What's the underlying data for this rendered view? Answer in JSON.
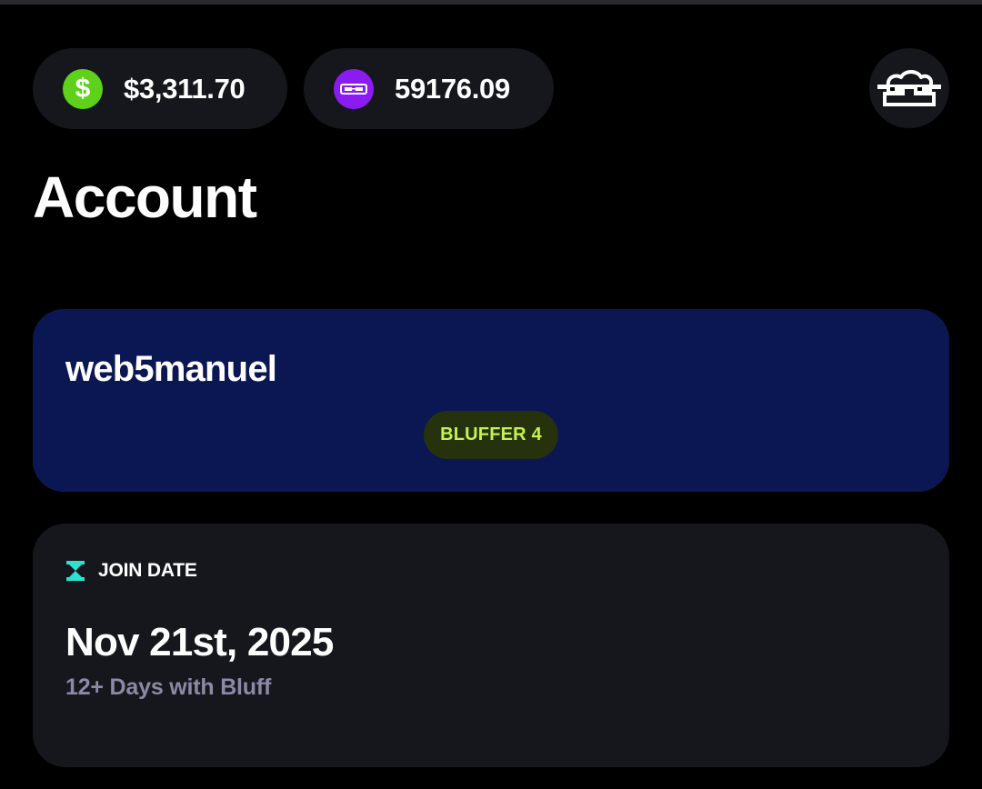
{
  "balances": {
    "cash": {
      "icon": "dollar-coin-icon",
      "symbol": "$",
      "amount": "$3,311.70"
    },
    "chips": {
      "icon": "bluff-token-icon",
      "amount": "59176.09"
    }
  },
  "avatar": {
    "icon": "pixel-sunglasses-avatar-icon"
  },
  "page": {
    "title": "Account"
  },
  "profile": {
    "username": "web5manuel",
    "rank": "BLUFFER 4"
  },
  "join": {
    "icon": "hourglass-icon",
    "label": "JOIN DATE",
    "date": "Nov 21st, 2025",
    "subtitle": "12+ Days with Bluff"
  },
  "colors": {
    "background": "#000000",
    "card": "#16171d",
    "profile_card": "#0b1753",
    "cash_green": "#5ed11a",
    "token_purple": "#8a1cf2",
    "rank_text": "#c6f250",
    "hourglass_teal": "#2de0d0",
    "muted_text": "#8b89a6"
  }
}
